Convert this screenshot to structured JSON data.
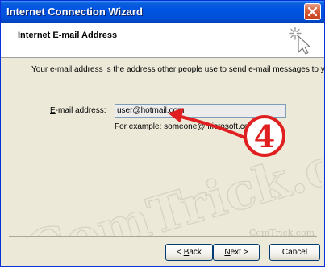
{
  "window": {
    "title": "Internet Connection Wizard"
  },
  "header": {
    "title": "Internet E-mail Address"
  },
  "main": {
    "description": "Your e-mail address is the address other people use to send e-mail messages to you.",
    "email_label": "E-mail address:",
    "email_value": "user@hotmail.com",
    "example_text": "For example: someone@microsoft.com"
  },
  "buttons": {
    "back_label": "< Back",
    "next_label": "Next >",
    "cancel_label": "Cancel"
  },
  "annotation": {
    "step_number": "4"
  },
  "watermarks": {
    "large_text": "ComTrick.com",
    "small_text": "ComTrick.com"
  },
  "icons": {
    "close": "close-icon",
    "wizard": "wand-icon"
  },
  "colors": {
    "titlebar": "#0054e3",
    "annotation_red": "#e02020",
    "dialog_bg": "#ece9d8"
  }
}
